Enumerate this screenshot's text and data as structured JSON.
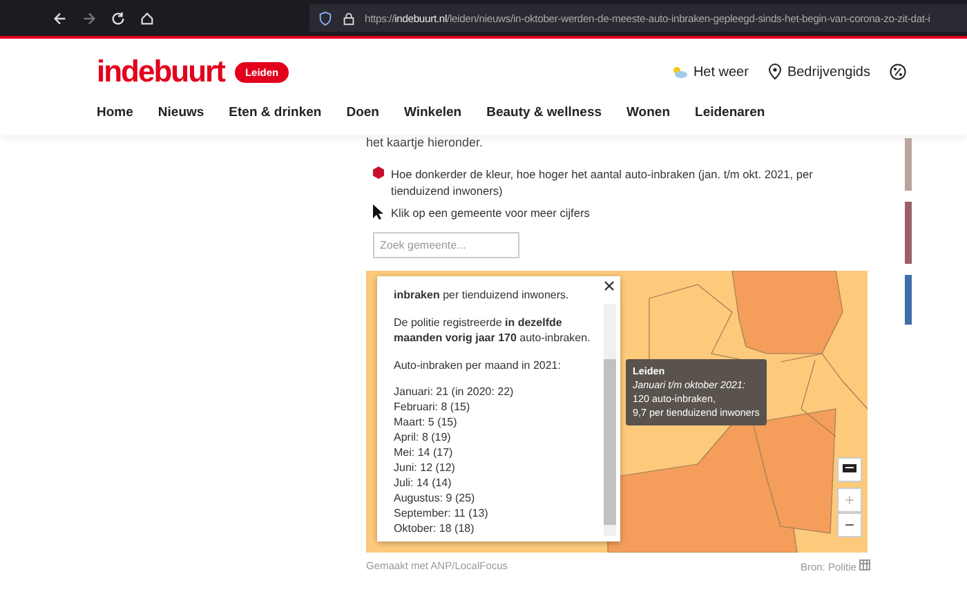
{
  "browser": {
    "url_prefix": "https://",
    "url_domain": "indebuurt.nl",
    "url_path": "/leiden/nieuws/in-oktober-werden-de-meeste-auto-inbraken-gepleegd-sinds-het-begin-van-corona-zo-zit-dat-i"
  },
  "header": {
    "logo": "indebuurt",
    "city": "Leiden",
    "links": [
      "Het weer",
      "Bedrijvengids"
    ]
  },
  "nav": [
    {
      "label": "Home",
      "selected": false
    },
    {
      "label": "Nieuws",
      "selected": false
    },
    {
      "label": "Eten & drinken",
      "selected": false
    },
    {
      "label": "Doen",
      "selected": false
    },
    {
      "label": "Winkelen",
      "selected": false
    },
    {
      "label": "Beauty & wellness",
      "selected": false
    },
    {
      "label": "Wonen",
      "selected": false
    },
    {
      "label": "Leidenaren",
      "selected": false
    }
  ],
  "article": {
    "intro": "het kaartje hieronder.",
    "legend": [
      {
        "kind": "dot",
        "text": "Hoe donkerder de kleur, hoe hoger het aantal auto-inbraken (jan. t/m okt. 2021, per tienduizend inwoners)",
        "color": "#c8102e"
      },
      {
        "kind": "pointer",
        "text": "Klik op een gemeente voor meer cijfers"
      }
    ],
    "search": {
      "placeholder": "Zoek gemeente..."
    }
  },
  "popup": {
    "paragraphs": [
      "**inbraken** per tienduizend inwoners.",
      "De politie registreerde **in dezelfde maanden vorig jaar 170** auto-inbraken.",
      "Auto-inbraken per maand in 2021:"
    ],
    "months": [
      "Januari: 21 (in 2020: 22)",
      "Februari: 8 (15)",
      "Maart: 5 (15)",
      "April: 8 (19)",
      "Mei: 14 (17)",
      "Juni: 12 (12)",
      "Juli: 14 (14)",
      "Augustus: 9 (25)",
      "September: 11 (13)",
      "Oktober: 18 (18)"
    ]
  },
  "tooltip": {
    "title": "Leiden",
    "period": "Januari t/m oktober 2021:",
    "lines": [
      "120 auto-inbraken,",
      "9,7 per tienduizend inwoners"
    ]
  },
  "zoom": {
    "in": "+",
    "out": "−",
    "in_disabled": true
  },
  "footer": {
    "credit": "Gemaakt met ANP/LocalFocus",
    "source": "Bron: Politie"
  }
}
